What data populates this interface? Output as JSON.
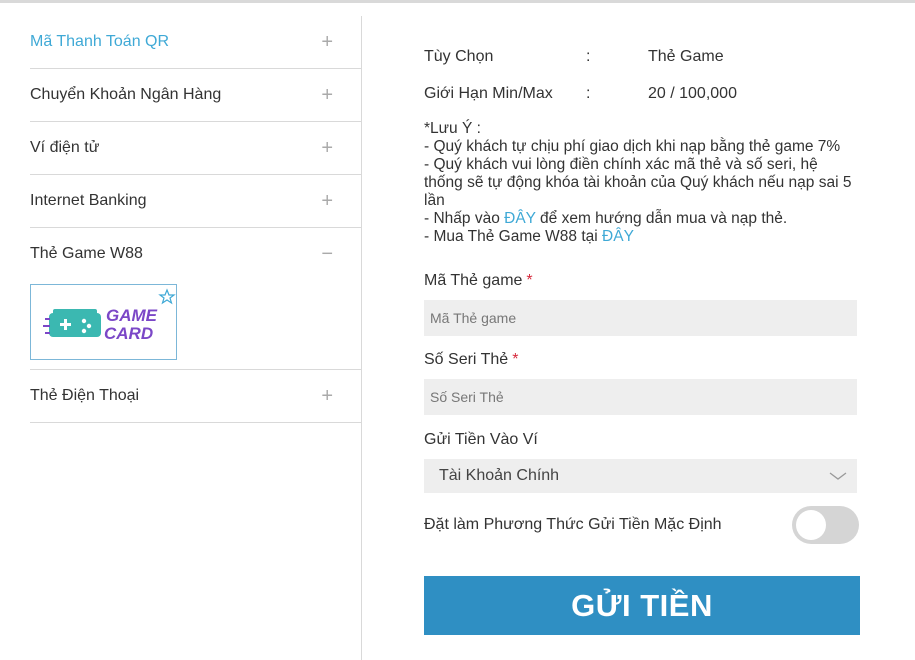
{
  "sidebar": {
    "items": [
      {
        "label": "Mã Thanh Toán QR",
        "toggle": "+"
      },
      {
        "label": "Chuyển Khoản Ngân Hàng",
        "toggle": "+"
      },
      {
        "label": "Ví điện tử",
        "toggle": "+"
      },
      {
        "label": "Internet Banking",
        "toggle": "+"
      },
      {
        "label": "Thẻ Game W88",
        "toggle": "−"
      },
      {
        "label": "Thẻ Điện Thoại",
        "toggle": "+"
      }
    ],
    "game_card_logo": {
      "line1": "GAME",
      "line2": "CARD"
    }
  },
  "info": {
    "option_label": "Tùy Chọn",
    "option_value": "Thẻ Game",
    "limit_label": "Giới Hạn Min/Max",
    "limit_value": "20 / 100,000",
    "separator": ":"
  },
  "note": {
    "title": "*Lưu Ý :",
    "line1": "- Quý khách tự chịu phí giao dịch khi nạp bằng thẻ game 7%",
    "line2": "- Quý khách vui lòng điền chính xác mã thẻ và số seri, hệ thống sẽ tự động khóa tài khoản của Quý khách nếu nạp sai 5 lần",
    "line3_prefix": "- Nhấp vào ",
    "line3_link": "ĐÂY",
    "line3_suffix": " để xem hướng dẫn mua và nạp thẻ.",
    "line4_prefix": "- Mua Thẻ Game W88 tại ",
    "line4_link": "ĐÂY"
  },
  "form": {
    "card_code_label": "Mã Thẻ game",
    "card_code_placeholder": "Mã Thẻ game",
    "serial_label": "Số Seri Thẻ",
    "serial_placeholder": "Số Seri Thẻ",
    "required_mark": "*",
    "wallet_label": "Gửi Tiền Vào Ví",
    "wallet_value": "Tài Khoản Chính",
    "default_label": "Đặt làm Phương Thức Gửi Tiền Mặc Định",
    "default_on": false,
    "submit_label": "GỬI TIỀN"
  },
  "colors": {
    "accent": "#3fa9d6",
    "button": "#2f8fc3",
    "required": "#d6293c",
    "logo_purple": "#7b47c7",
    "logo_teal": "#33b3ad"
  }
}
